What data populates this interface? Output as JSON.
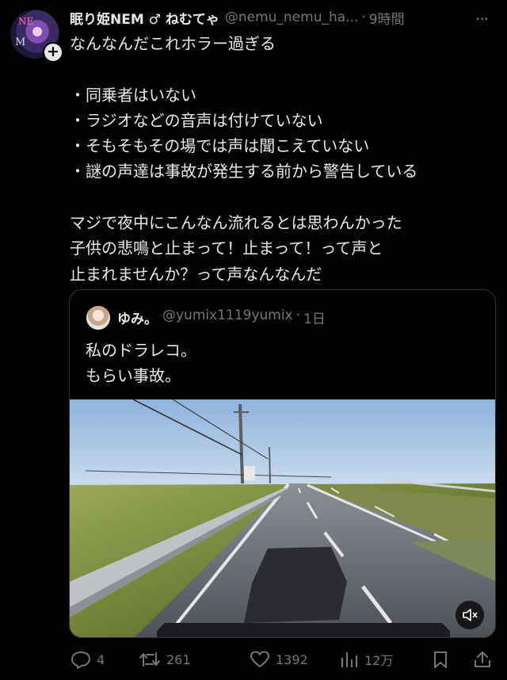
{
  "tweet": {
    "display_name": "眠り姫NEM ♂ ねむてゃ",
    "handle": "@nemu_nemu_ha...",
    "separator": "·",
    "time": "9時間",
    "more_label": "···",
    "avatar_letters": {
      "top": "NE",
      "bottom": "M"
    },
    "follow_symbol": "+",
    "lines": [
      "なんなんだこれホラー過ぎる",
      "",
      "・同乗者はいない",
      "・ラジオなどの音声は付けていない",
      "・そもそもその場では声は聞こえていない",
      "・謎の声達は事故が発生する前から警告している",
      "",
      "マジで夜中にこんなん流れるとは思わんかった",
      "子供の悲鳴と止まって！止まって！って声と",
      "止まれませんか？って声なんなんだ"
    ]
  },
  "quote": {
    "display_name": "ゆみ。",
    "handle": "@yumix1119yumix",
    "separator": "·",
    "time": "1日",
    "lines": [
      "私のドラレコ。",
      "もらい事故。"
    ]
  },
  "actions": {
    "replies": "4",
    "retweets": "261",
    "likes": "1392",
    "views": "12万"
  },
  "colors": {
    "background": "#000000",
    "text": "#e7e9ea",
    "secondary": "#71767b",
    "border": "#2f3336"
  },
  "icons": [
    "more-icon",
    "follow-plus-icon",
    "mute-icon",
    "reply-icon",
    "retweet-icon",
    "like-icon",
    "views-icon",
    "bookmark-icon",
    "share-icon"
  ]
}
